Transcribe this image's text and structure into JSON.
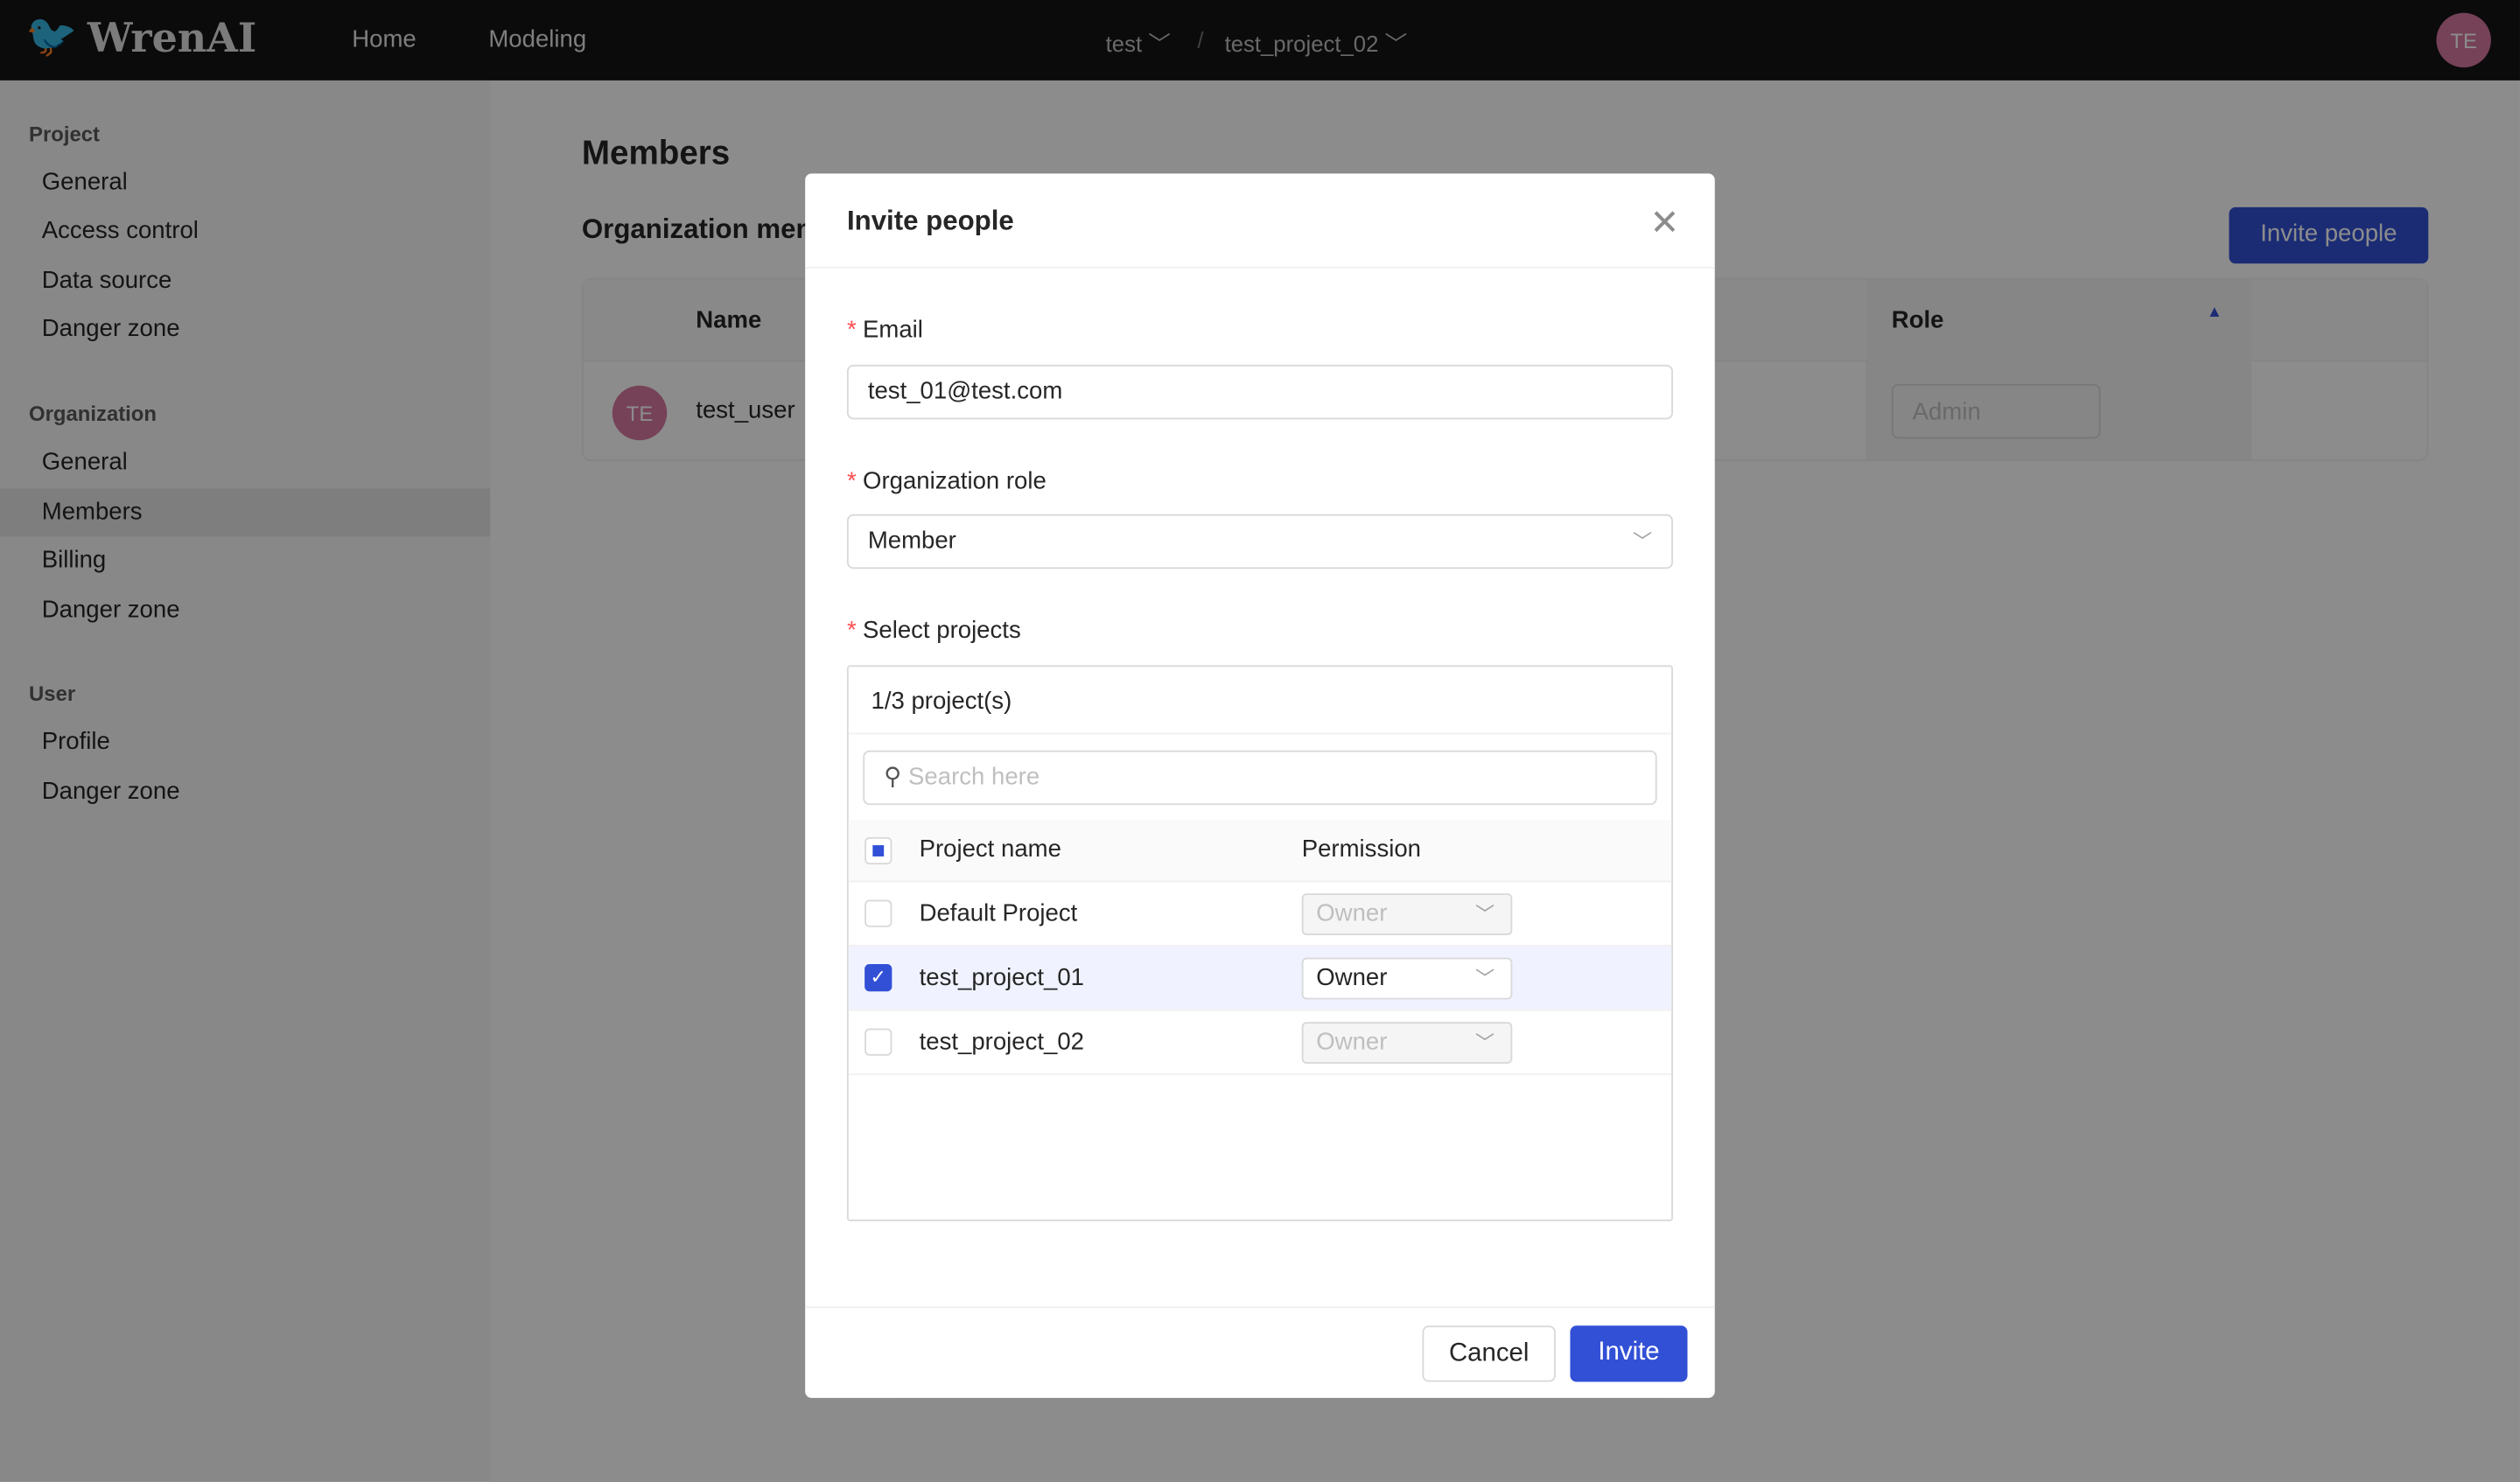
{
  "topbar": {
    "logo": "WrenAI",
    "nav": [
      "Home",
      "Modeling"
    ],
    "org": "test",
    "project": "test_project_02",
    "avatar": "TE"
  },
  "sidebar": {
    "sections": [
      {
        "title": "Project",
        "items": [
          "General",
          "Access control",
          "Data source",
          "Danger zone"
        ]
      },
      {
        "title": "Organization",
        "items": [
          "General",
          "Members",
          "Billing",
          "Danger zone"
        ]
      },
      {
        "title": "User",
        "items": [
          "Profile",
          "Danger zone"
        ]
      }
    ],
    "active": "Members"
  },
  "main": {
    "title": "Members",
    "subtitle": "Organization members",
    "invite_button": "Invite people",
    "columns": [
      "Name",
      "Role"
    ],
    "rows": [
      {
        "avatar": "TE",
        "name": "test_user",
        "role": "Admin"
      }
    ]
  },
  "modal": {
    "title": "Invite people",
    "email_label": "Email",
    "email_value": "test_01@test.com",
    "role_label": "Organization role",
    "role_value": "Member",
    "projects_label": "Select projects",
    "projects_count": "1/3 project(s)",
    "search_placeholder": "Search here",
    "col_project": "Project name",
    "col_permission": "Permission",
    "projects": [
      {
        "name": "Default Project",
        "permission": "Owner",
        "checked": false
      },
      {
        "name": "test_project_01",
        "permission": "Owner",
        "checked": true
      },
      {
        "name": "test_project_02",
        "permission": "Owner",
        "checked": false
      }
    ],
    "cancel": "Cancel",
    "invite": "Invite"
  },
  "colors": {
    "primary": "#3250d6",
    "topbar": "#141414"
  }
}
